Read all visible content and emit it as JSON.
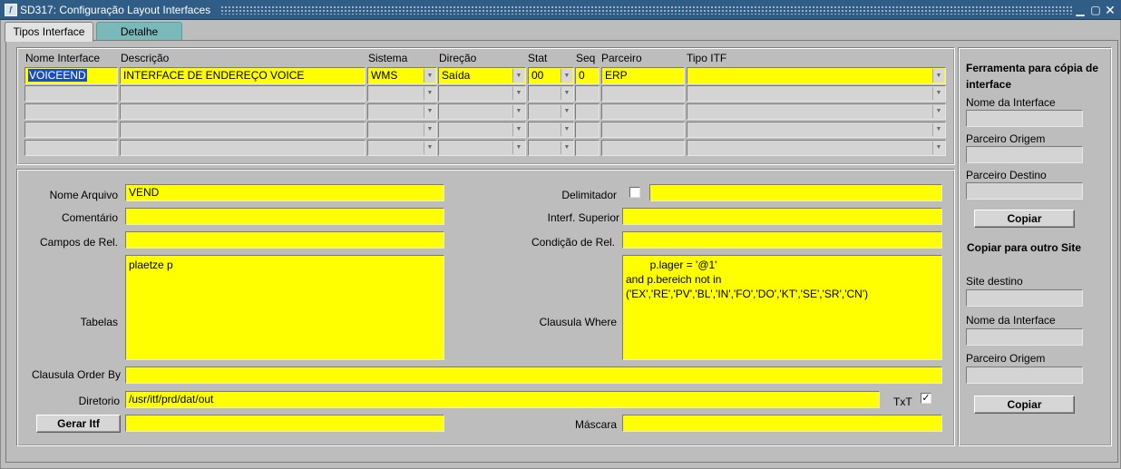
{
  "window": {
    "title": "SD317: Configuração Layout Interfaces",
    "icon": "oracle-forms-icon",
    "controls": [
      "minimize",
      "maximize",
      "close"
    ]
  },
  "tabs": [
    {
      "label": "Tipos Interface",
      "active": true
    },
    {
      "label": "Detalhe",
      "active": false
    }
  ],
  "grid": {
    "headers": {
      "nome_interface": "Nome Interface",
      "descricao": "Descrição",
      "sistema": "Sistema",
      "direcao": "Direção",
      "stat": "Stat",
      "seq": "Seq",
      "parceiro": "Parceiro",
      "tipo_itf": "Tipo ITF"
    },
    "rows": [
      {
        "nome_interface": "VOICEEND",
        "descricao": "INTERFACE DE ENDEREÇO VOICE",
        "sistema": "WMS",
        "direcao": "Saída",
        "stat": "00",
        "seq": "0",
        "parceiro": "ERP",
        "tipo_itf": ""
      }
    ],
    "empty_rows": 4
  },
  "detail": {
    "nome_arquivo": {
      "label": "Nome Arquivo",
      "value": "VEND"
    },
    "comentario": {
      "label": "Comentário",
      "value": ""
    },
    "campos_rel": {
      "label": "Campos de Rel.",
      "value": ""
    },
    "tabelas": {
      "label": "Tabelas",
      "value": "plaetze p"
    },
    "clausula_order_by": {
      "label": "Clausula Order By",
      "value": ""
    },
    "diretorio": {
      "label": "Diretorio",
      "value": "/usr/itf/prd/dat/out"
    },
    "txt": {
      "label": "TxT",
      "checked": true
    },
    "gerar_itf": {
      "label": "Gerar Itf",
      "value": ""
    },
    "delimitador": {
      "label": "Delimitador",
      "checked": false,
      "value": ""
    },
    "interf_superior": {
      "label": "Interf. Superior",
      "value": ""
    },
    "condicao_rel": {
      "label": "Condição de Rel.",
      "value": ""
    },
    "clausula_where": {
      "label": "Clausula Where",
      "value": "        p.lager = '@1'\nand p.bereich not in\n('EX','RE','PV','BL','IN','FO','DO','KT','SE','SR','CN')"
    },
    "mascara": {
      "label": "Máscara",
      "value": ""
    }
  },
  "side": {
    "copy_tool": {
      "title": "Ferramenta para cópia de interface",
      "nome_interface_label": "Nome da Interface",
      "nome_interface_value": "",
      "parceiro_origem_label": "Parceiro Origem",
      "parceiro_origem_value": "",
      "parceiro_destino_label": "Parceiro Destino",
      "parceiro_destino_value": "",
      "button": "Copiar"
    },
    "copy_site": {
      "title": "Copiar para outro Site",
      "site_destino_label": "Site destino",
      "site_destino_value": "",
      "nome_interface_label": "Nome da Interface",
      "nome_interface_value": "",
      "parceiro_origem_label": "Parceiro Origem",
      "parceiro_origem_value": "",
      "button": "Copiar"
    }
  },
  "colors": {
    "titlebar": "#2f5d85",
    "field_required": "#ffff00",
    "field_disabled": "#d4d4d4",
    "background": "#bdbdbd",
    "tab_inactive": "#79b9b9",
    "selection": "#1b4fb5"
  }
}
